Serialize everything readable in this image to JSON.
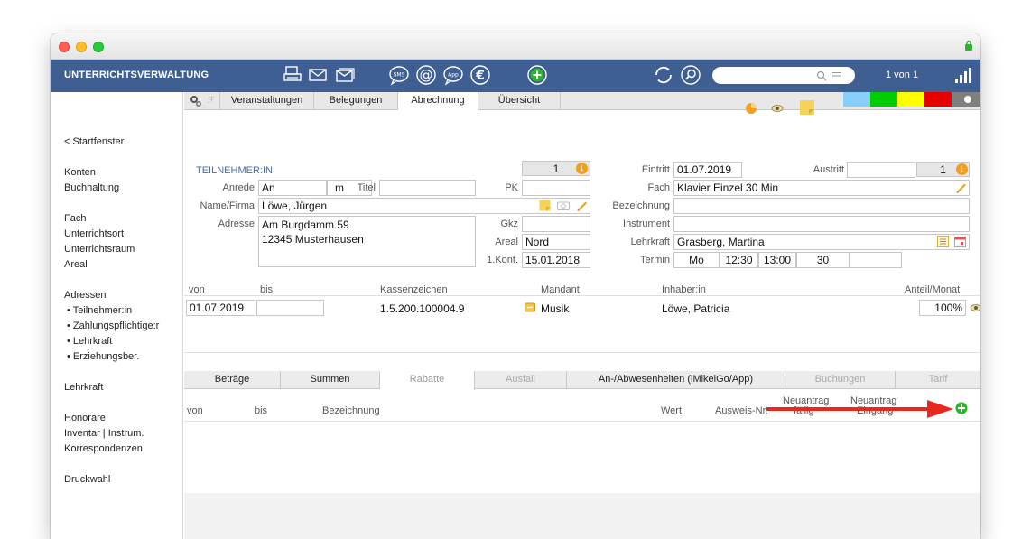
{
  "app": {
    "title": "UNTERRICHTSVERWALTUNG",
    "pager": "1 von 1",
    "search_placeholder": ""
  },
  "sidebar": {
    "back": "< Startfenster",
    "items": [
      "Konten",
      "Buchhaltung",
      "Fach",
      "Unterrichtsort",
      "Unterrichtsraum",
      "Areal",
      "Adressen",
      "• Teilnehmer:in",
      "• Zahlungspflichtige:r",
      "• Lehrkraft",
      "• Erziehungsber.",
      "Lehrkraft",
      "Honorare",
      "Inventar | Instrum.",
      "Korrespondenzen",
      "Druckwahl"
    ]
  },
  "tabs": [
    "Veranstaltungen",
    "Belegungen",
    "Abrechnung",
    "Übersicht"
  ],
  "colors": {
    "topbar": "#3f5f93",
    "swatches": [
      "#87cefa",
      "#00cc00",
      "#ffff00",
      "#e60000",
      "#7f7f7f"
    ],
    "accent_orange": "#f0a020",
    "add_green": "#2bb52b",
    "remove_red": "#d62020",
    "arrow_red": "#e8281e"
  },
  "left_form": {
    "section": "TEILNEHMER:IN",
    "count": "1",
    "anrede_label": "Anrede",
    "anrede_value": "An",
    "gender_value": "m",
    "titel_label": "Titel",
    "titel_value": "",
    "pk_label": "PK",
    "pk_value": "",
    "name_label": "Name/Firma",
    "name_value": "Löwe, Jürgen",
    "adresse_label": "Adresse",
    "adresse_line1": "Am Burgdamm 59",
    "adresse_line2": "12345 Musterhausen",
    "gkz_label": "Gkz",
    "gkz_value": "",
    "areal_label": "Areal",
    "areal_value": "Nord",
    "kont_label": "1.Kont.",
    "kont_value": "15.01.2018"
  },
  "right_form": {
    "eintritt_label": "Eintritt",
    "eintritt_value": "01.07.2019",
    "austritt_label": "Austritt",
    "austritt_value": "",
    "austritt_count": "1",
    "fach_label": "Fach",
    "fach_value": "Klavier Einzel 30 Min",
    "bezeichnung_label": "Bezeichnung",
    "bezeichnung_value": "",
    "instrument_label": "Instrument",
    "instrument_value": "",
    "lehrkraft_label": "Lehrkraft",
    "lehrkraft_value": "Grasberg, Martina",
    "termin_label": "Termin",
    "termin_day": "Mo",
    "termin_from": "12:30",
    "termin_to": "13:00",
    "termin_duration": "30",
    "termin_extra": ""
  },
  "billing": {
    "headers": [
      "von",
      "bis",
      "Kassenzeichen",
      "Mandant",
      "Inhaber:in",
      "Anteil/Monat"
    ],
    "row": {
      "von": "01.07.2019",
      "bis": "",
      "kassenzeichen": "1.5.200.100004.9",
      "mandant": "Musik",
      "inhaber": "Löwe, Patricia",
      "anteil": "100%"
    }
  },
  "subtabs": [
    "Beträge",
    "Summen",
    "Rabatte",
    "Ausfall",
    "An-/Abwesenheiten (iMikelGo/App)",
    "Buchungen",
    "Tarif"
  ],
  "discounts": {
    "headers": {
      "von": "von",
      "bis": "bis",
      "bezeichnung": "Bezeichnung",
      "wert": "Wert",
      "ausweis": "Ausweis-Nr.",
      "neuantrag1_top": "Neuantrag",
      "neuantrag1_bottom": "fällig",
      "neuantrag2_top": "Neuantrag",
      "neuantrag2_bottom": "Eingang"
    }
  }
}
